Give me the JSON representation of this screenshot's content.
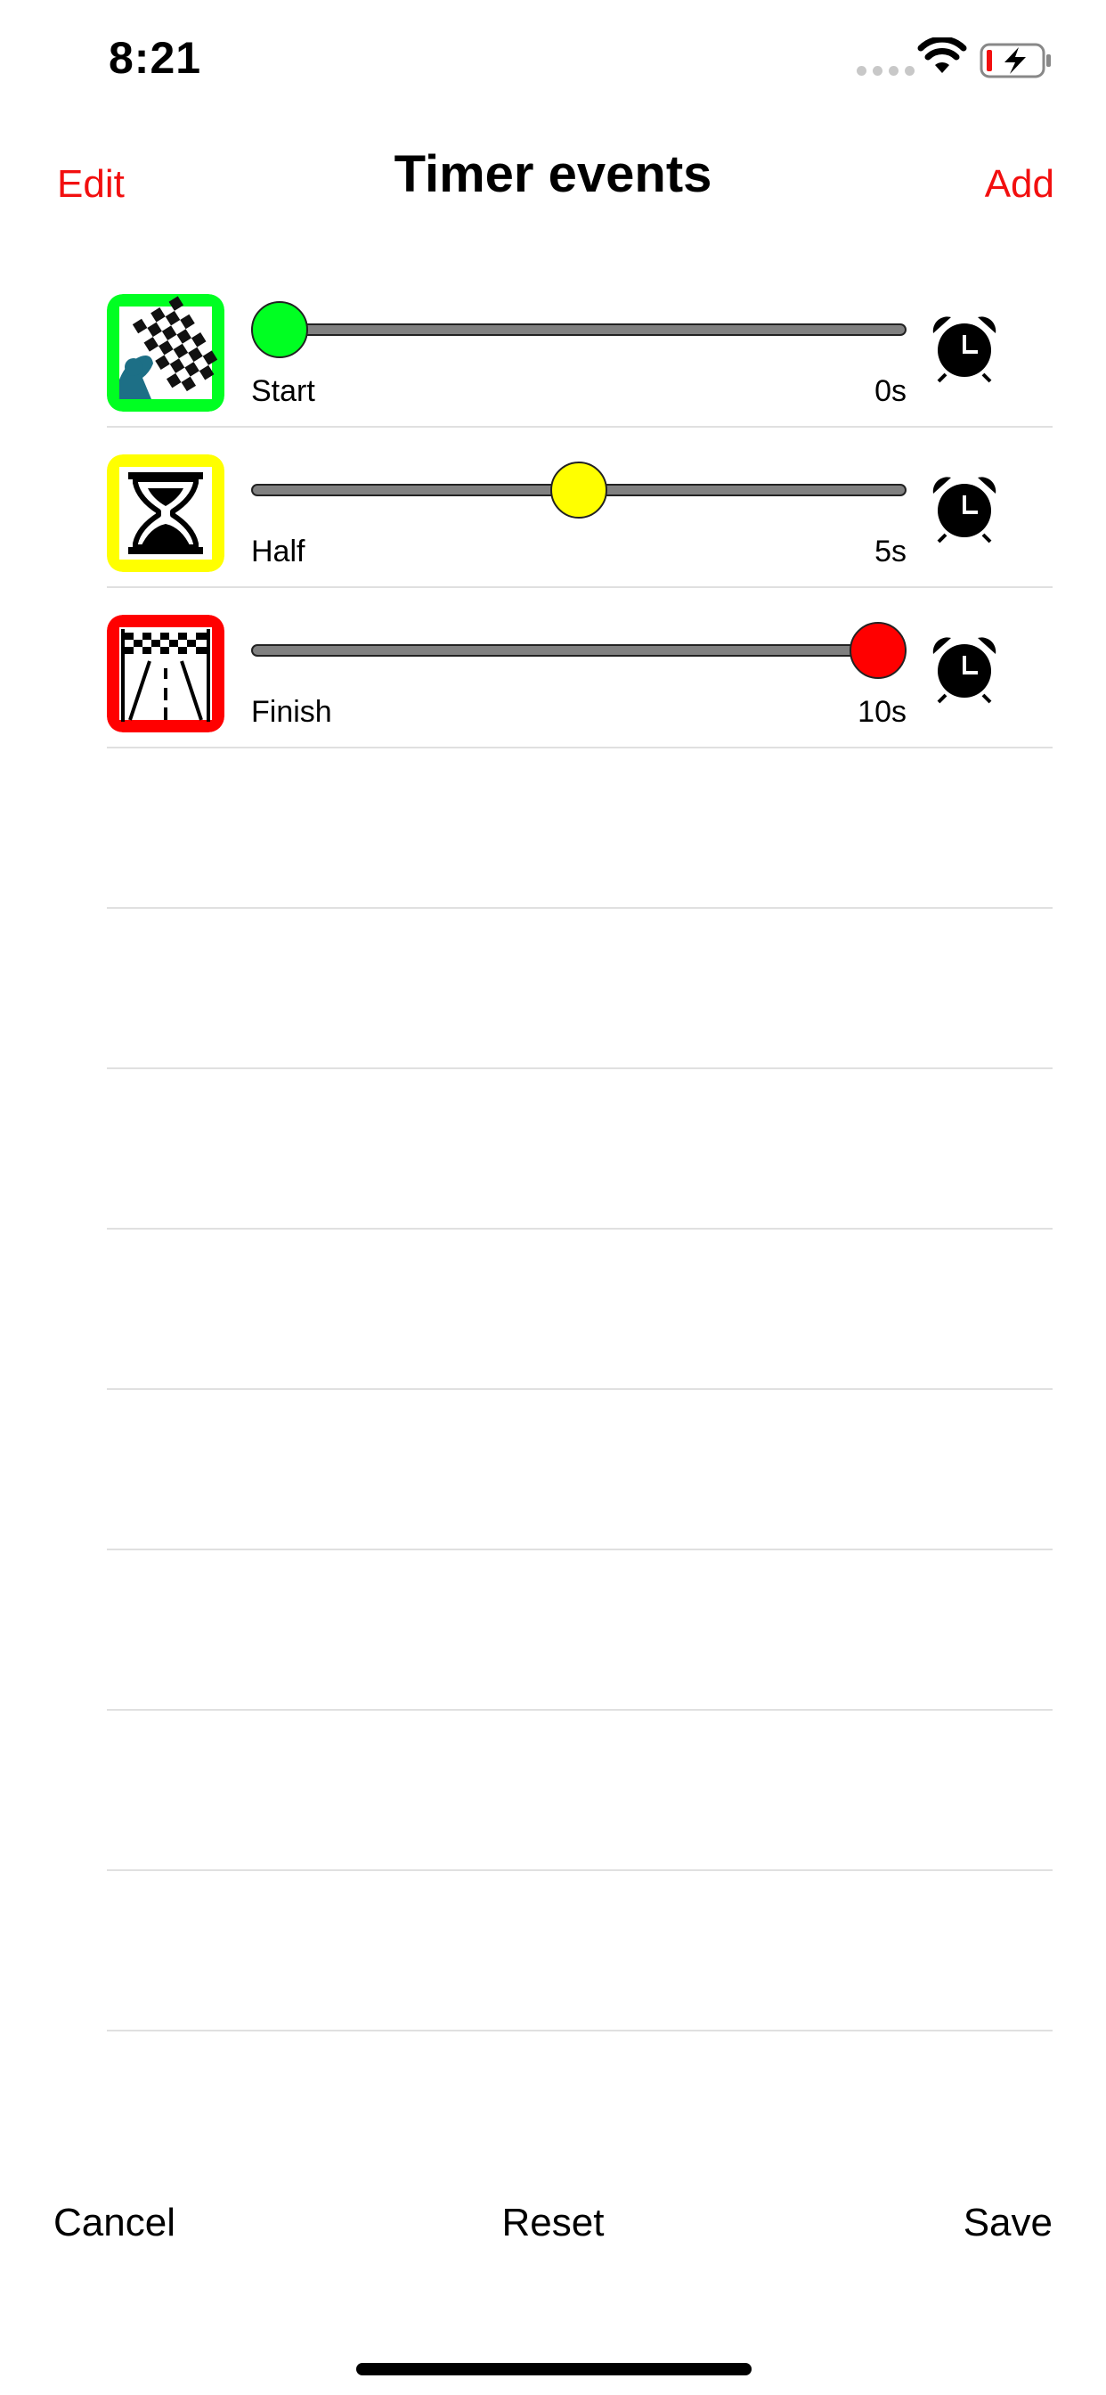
{
  "status": {
    "time": "8:21"
  },
  "nav": {
    "edit_label": "Edit",
    "title": "Timer events",
    "add_label": "Add"
  },
  "events": [
    {
      "label": "Start",
      "time": "0s",
      "value_seconds": 0,
      "color": "#00ff22",
      "icon": "race-start-flag-icon"
    },
    {
      "label": "Half",
      "time": "5s",
      "value_seconds": 5,
      "color": "#ffff00",
      "icon": "hourglass-icon"
    },
    {
      "label": "Finish",
      "time": "10s",
      "value_seconds": 10,
      "color": "#ff0000",
      "icon": "finish-line-icon"
    }
  ],
  "slider_max_seconds": 10,
  "accent_color": "#f20f0f",
  "bottom": {
    "cancel_label": "Cancel",
    "reset_label": "Reset",
    "save_label": "Save"
  }
}
